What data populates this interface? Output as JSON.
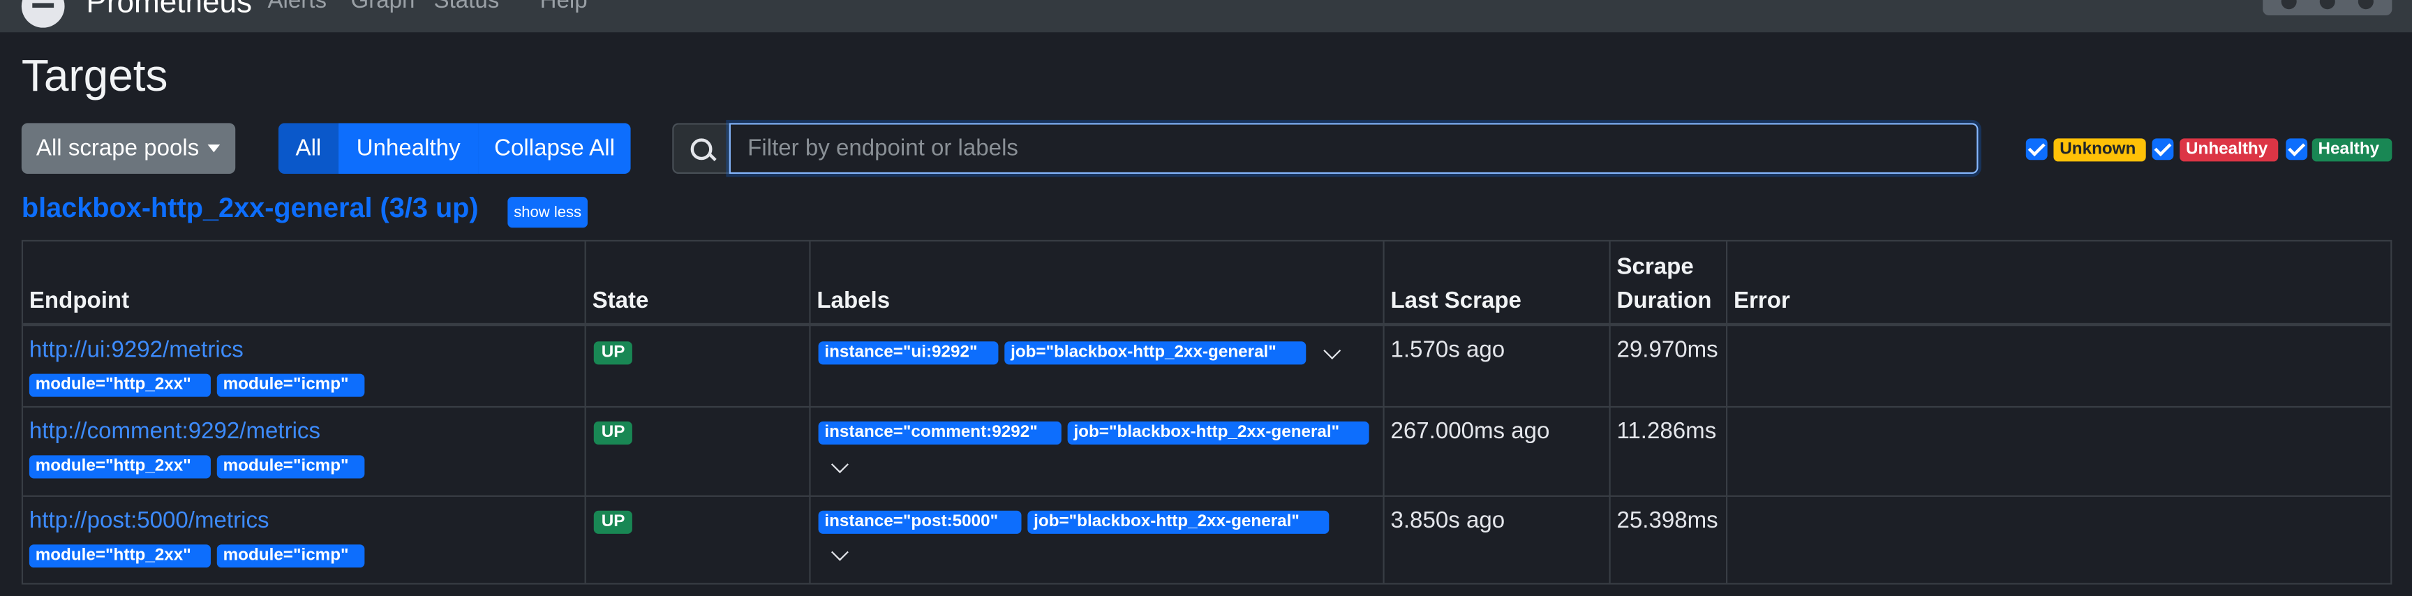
{
  "navbar": {
    "brand": "Prometheus",
    "links": [
      "Alerts",
      "Graph",
      "Status",
      "Help"
    ]
  },
  "page": {
    "title": "Targets"
  },
  "controls": {
    "scrape_pools_label": "All scrape pools",
    "filter_all": "All",
    "filter_unhealthy": "Unhealthy",
    "collapse_all": "Collapse All",
    "search_placeholder": "Filter by endpoint or labels",
    "search_value": ""
  },
  "health_filters": [
    {
      "label": "Unknown",
      "checked": true,
      "color": "#ffc107"
    },
    {
      "label": "Unhealthy",
      "checked": true,
      "color": "#dc3545"
    },
    {
      "label": "Healthy",
      "checked": true,
      "color": "#198754"
    }
  ],
  "pool": {
    "title": "blackbox-http_2xx-general (3/3 up)",
    "toggle_label": "show less"
  },
  "table": {
    "headers": {
      "endpoint": "Endpoint",
      "state": "State",
      "labels": "Labels",
      "last_scrape": "Last Scrape",
      "scrape_duration_1": "Scrape",
      "scrape_duration_2": "Duration",
      "error": "Error"
    },
    "rows": [
      {
        "endpoint": "http://ui:9292/metrics",
        "params": [
          "module=\"http_2xx\"",
          "module=\"icmp\""
        ],
        "state": "UP",
        "labels": [
          "instance=\"ui:9292\"",
          "job=\"blackbox-http_2xx-general\""
        ],
        "last_scrape": "1.570s ago",
        "scrape_duration": "29.970ms",
        "error": ""
      },
      {
        "endpoint": "http://comment:9292/metrics",
        "params": [
          "module=\"http_2xx\"",
          "module=\"icmp\""
        ],
        "state": "UP",
        "labels": [
          "instance=\"comment:9292\"",
          "job=\"blackbox-http_2xx-general\""
        ],
        "last_scrape": "267.000ms ago",
        "scrape_duration": "11.286ms",
        "error": ""
      },
      {
        "endpoint": "http://post:5000/metrics",
        "params": [
          "module=\"http_2xx\"",
          "module=\"icmp\""
        ],
        "state": "UP",
        "labels": [
          "instance=\"post:5000\"",
          "job=\"blackbox-http_2xx-general\""
        ],
        "last_scrape": "3.850s ago",
        "scrape_duration": "25.398ms",
        "error": ""
      }
    ]
  },
  "colors": {
    "primary": "#0d6efd",
    "success": "#198754",
    "warning": "#ffc107",
    "danger": "#dc3545",
    "background": "#1c1f26",
    "navbar": "#343a40"
  }
}
